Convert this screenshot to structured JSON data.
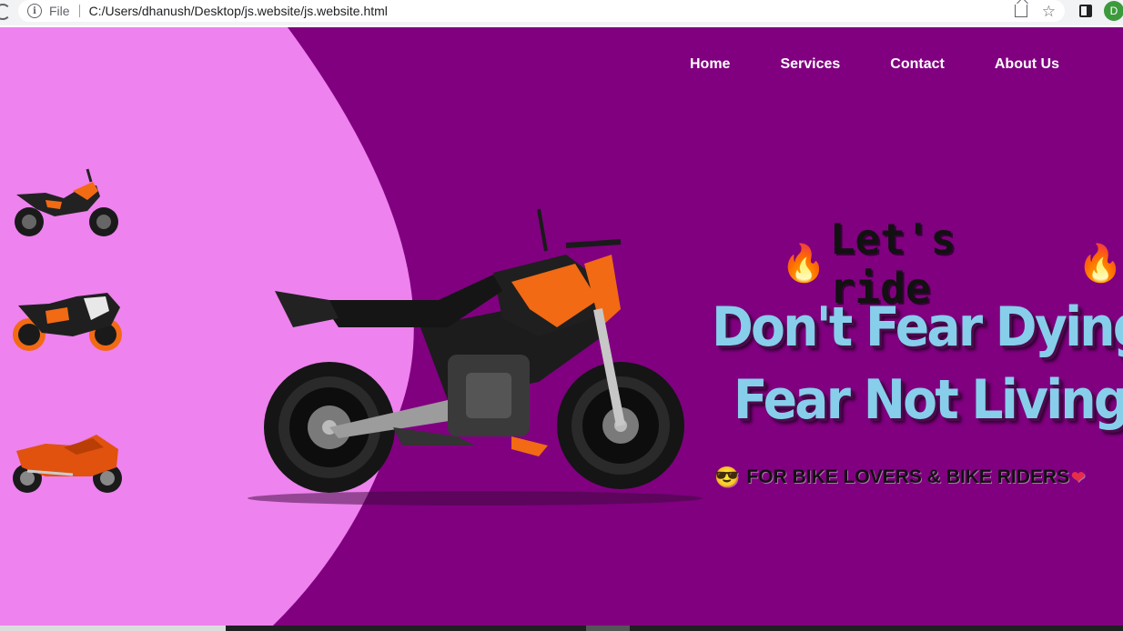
{
  "browser": {
    "file_label": "File",
    "url": "C:/Users/dhanush/Desktop/js.website/js.website.html",
    "avatar_letter": "D",
    "info_glyph": "i",
    "star_glyph": "☆"
  },
  "nav": {
    "items": [
      {
        "label": "Home"
      },
      {
        "label": "Services"
      },
      {
        "label": "Contact"
      },
      {
        "label": "About Us"
      }
    ]
  },
  "hero": {
    "lets_ride": "Let's ride",
    "fire_glyph": "🔥",
    "headline_line1": "Don't Fear Dying",
    "headline_line2": "Fear Not Living",
    "tagline": "FOR BIKE LOVERS & BIKE RIDERS",
    "tagline_emoji": "😎",
    "heart_glyph": "❤"
  },
  "colors": {
    "purple_bg": "#800080",
    "pink_bg": "#ee82ee",
    "headline": "#87ceeb",
    "nav_text": "#ffffff",
    "bike_orange": "#f26a14"
  },
  "icons": [
    "info-icon",
    "share-icon",
    "star-icon",
    "side-panel-icon",
    "fire-icon",
    "sunglasses-emoji-icon",
    "heart-icon"
  ]
}
